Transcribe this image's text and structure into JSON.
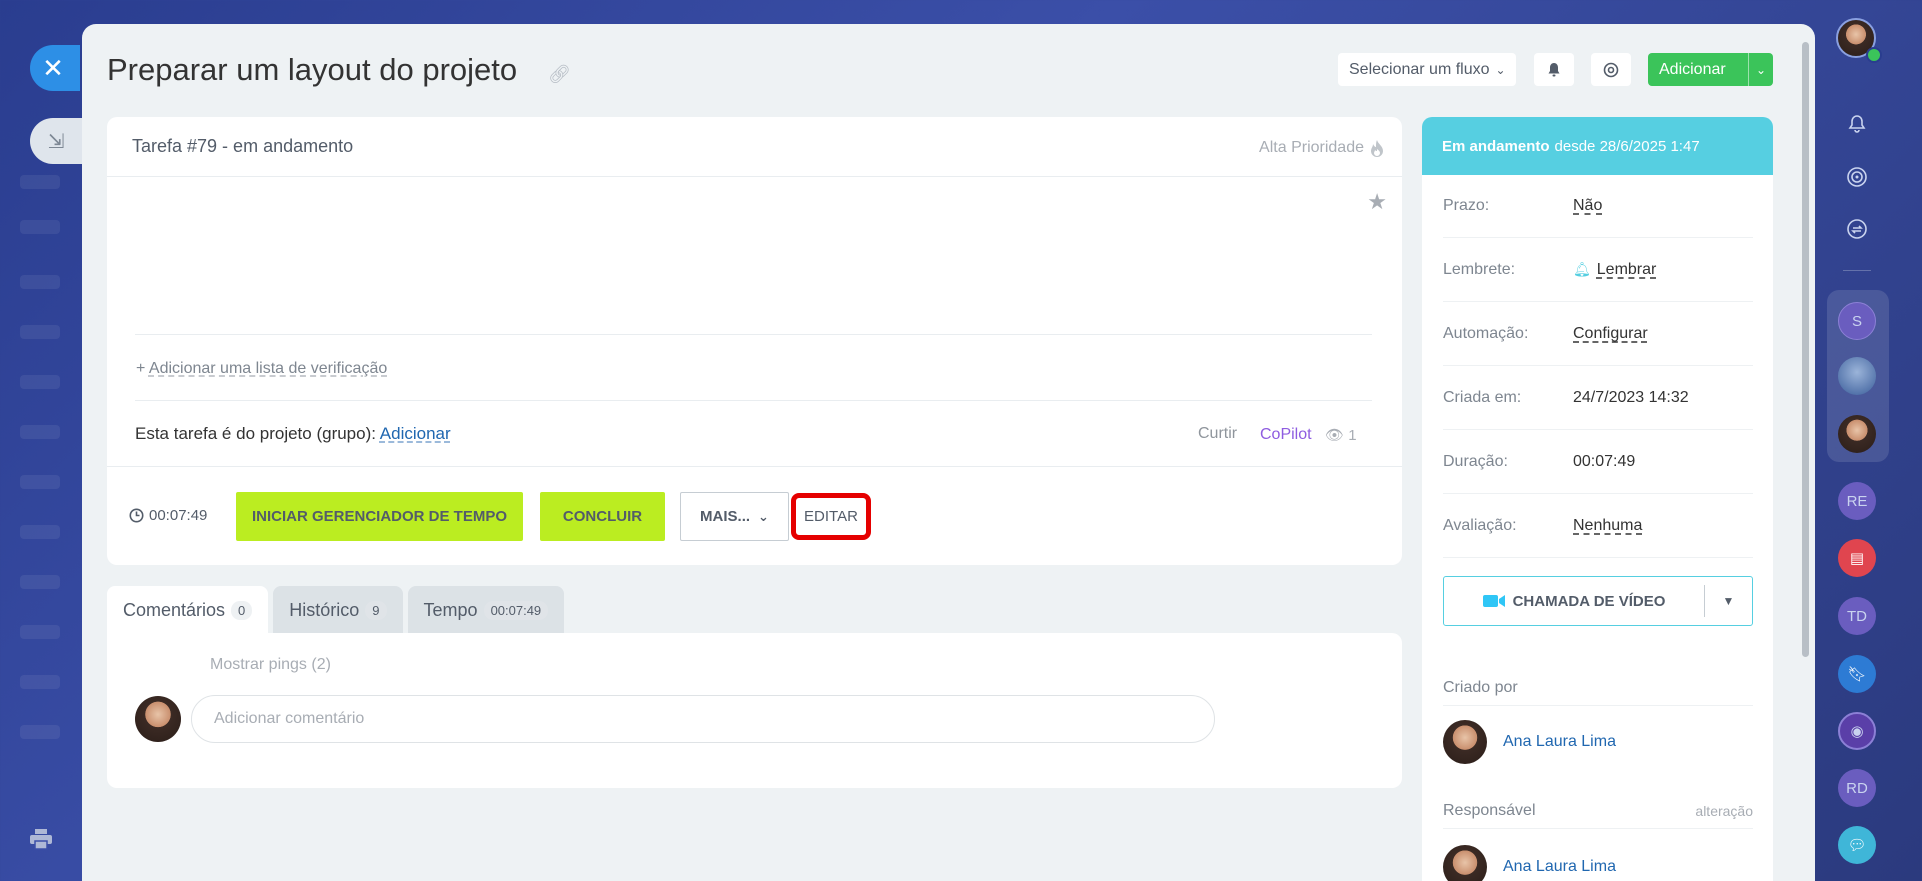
{
  "window": {
    "close_icon": "close-icon",
    "collapse_icon": "collapse-icon"
  },
  "header": {
    "title": "Preparar um layout do projeto",
    "flow_select": "Selecionar um fluxo",
    "add_button": "Adicionar"
  },
  "task": {
    "number_status": "Tarefa #79 - em andamento",
    "priority": "Alta Prioridade",
    "checklist_link": "Adicionar uma lista de verificação",
    "project_label": "Esta tarefa é do projeto (grupo):",
    "project_add": "Adicionar",
    "like": "Curtir",
    "copilot": "CoPilot",
    "views": "1",
    "timer": "00:07:49",
    "btn_timer": "INICIAR GERENCIADOR DE TEMPO",
    "btn_complete": "CONCLUIR",
    "btn_more": "MAIS...",
    "btn_edit": "EDITAR"
  },
  "tabs": [
    {
      "label": "Comentários",
      "count": "0"
    },
    {
      "label": "Histórico",
      "count": "9"
    },
    {
      "label": "Tempo",
      "count": "00:07:49"
    }
  ],
  "comments": {
    "show_pings": "Mostrar pings (2)",
    "placeholder": "Adicionar comentário"
  },
  "sidebar": {
    "status_bold": "Em andamento",
    "status_rest": "desde 28/6/2025 1:47",
    "rows": [
      {
        "key": "Prazo:",
        "value": "Não"
      },
      {
        "key": "Lembrete:",
        "value": "Lembrar"
      },
      {
        "key": "Automação:",
        "value": "Configurar"
      },
      {
        "key": "Criada em:",
        "value": "24/7/2023 14:32"
      },
      {
        "key": "Duração:",
        "value": "00:07:49"
      },
      {
        "key": "Avaliação:",
        "value": "Nenhuma"
      }
    ],
    "video_call": "CHAMADA DE VÍDEO",
    "created_by": "Criado por",
    "creator": "Ana Laura Lima",
    "responsible": "Responsável",
    "change": "alteração",
    "responsible_name": "Ana Laura Lima"
  },
  "rail": {
    "initials_s": "S",
    "initials_re": "RE",
    "initials_td": "TD",
    "initials_rd": "RD"
  },
  "colors": {
    "accent_green": "#bbed21",
    "add_green": "#3bc45a",
    "status_cyan": "#56cfe1",
    "edit_highlight": "#e50000"
  }
}
